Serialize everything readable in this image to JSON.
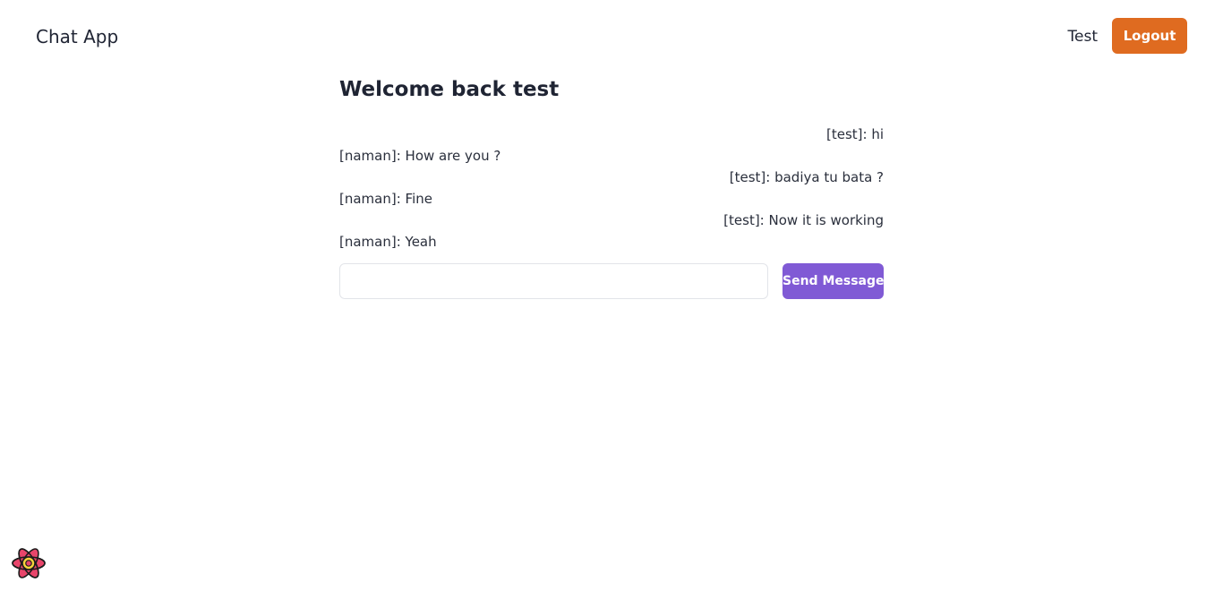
{
  "header": {
    "brand": "Chat App",
    "user_name": "Test",
    "logout_label": "Logout",
    "logout_color": "#df6b20"
  },
  "chat": {
    "welcome": "Welcome back test",
    "messages": [
      {
        "text": "[test]: hi",
        "side": "right"
      },
      {
        "text": "[naman]: How are you ?",
        "side": "left"
      },
      {
        "text": "[test]: badiya tu bata ?",
        "side": "right"
      },
      {
        "text": "[naman]: Fine",
        "side": "left"
      },
      {
        "text": "[test]: Now it is working",
        "side": "right"
      },
      {
        "text": "[naman]: Yeah",
        "side": "left"
      }
    ],
    "input_value": "",
    "input_placeholder": "",
    "send_label": "Send Message",
    "send_color": "#805ad5"
  },
  "corner": {
    "icon": "react-devtools-icon"
  }
}
